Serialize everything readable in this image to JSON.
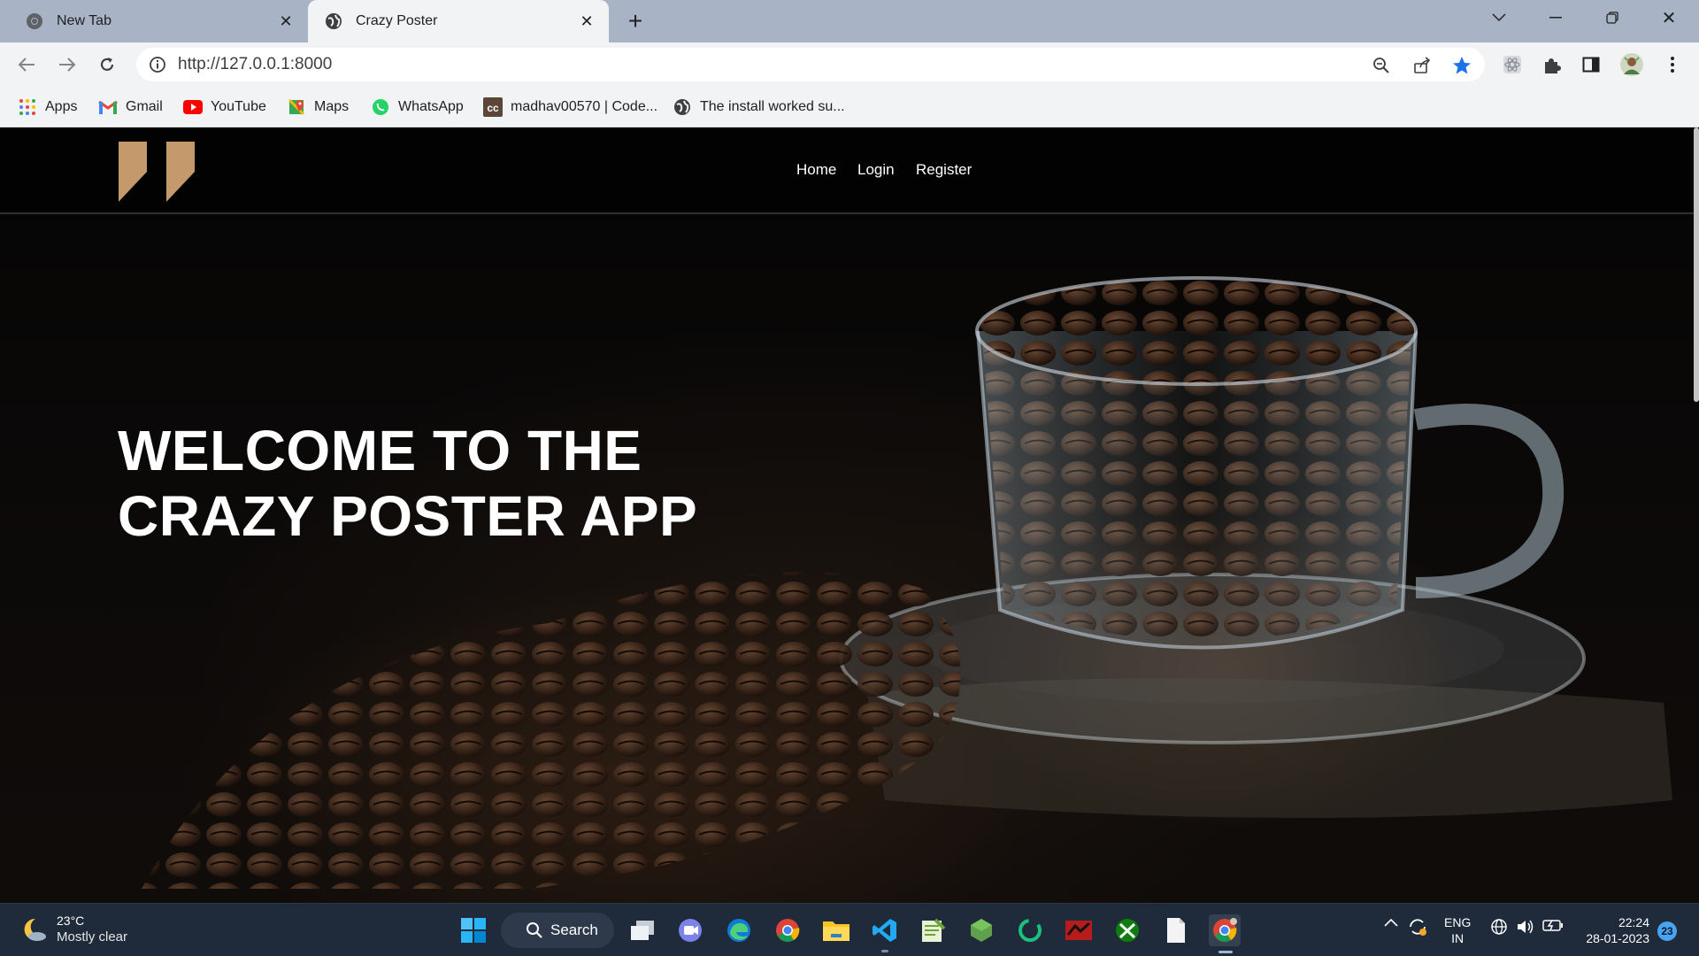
{
  "browser": {
    "tabs": [
      {
        "title": "New Tab",
        "icon": "chrome-icon",
        "active": false
      },
      {
        "title": "Crazy Poster",
        "icon": "globe-icon",
        "active": true
      }
    ],
    "url": "http://127.0.0.1:8000",
    "bookmarks": [
      {
        "label": "Apps",
        "icon": "apps-grid-icon"
      },
      {
        "label": "Gmail",
        "icon": "gmail-icon"
      },
      {
        "label": "YouTube",
        "icon": "youtube-icon"
      },
      {
        "label": "Maps",
        "icon": "maps-icon"
      },
      {
        "label": "WhatsApp",
        "icon": "whatsapp-icon"
      },
      {
        "label": "madhav00570 | Code...",
        "icon": "codechef-icon"
      },
      {
        "label": "The install worked su...",
        "icon": "globe-icon"
      }
    ]
  },
  "site": {
    "nav": [
      {
        "label": "Home"
      },
      {
        "label": "Login"
      },
      {
        "label": "Register"
      }
    ],
    "hero_title": "WELCOME TO THE CRAZY POSTER APP",
    "logo_color": "#c49a6c"
  },
  "taskbar": {
    "weather_temp": "23°C",
    "weather_desc": "Mostly clear",
    "search_label": "Search",
    "lang_top": "ENG",
    "lang_bottom": "IN",
    "time": "22:24",
    "date": "28-01-2023",
    "notification_count": "23"
  }
}
